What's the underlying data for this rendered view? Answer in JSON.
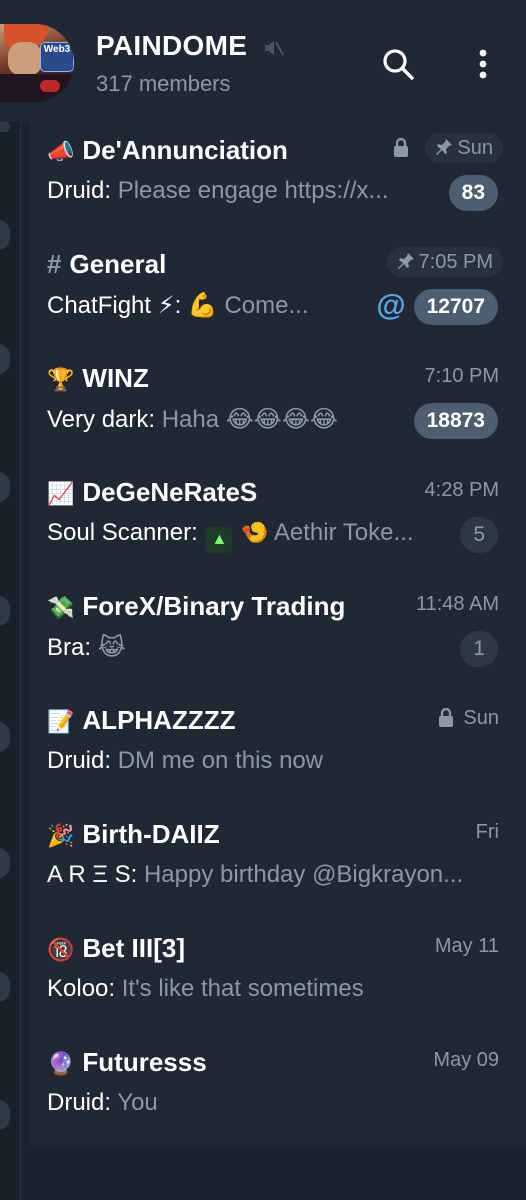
{
  "header": {
    "title": "PAINDOME",
    "subtitle": "317 members",
    "avatar_text": "Web3"
  },
  "chats": [
    {
      "icon": "📣",
      "name": "De'Annunciation",
      "time": "Sun",
      "pinned": true,
      "locked": true,
      "sender": "Druid:",
      "message": "Please engage   https://x...",
      "badge": "83",
      "badge_muted": false
    },
    {
      "icon": "#",
      "name": "General",
      "time": "7:05 PM",
      "pinned": true,
      "locked": false,
      "sender": "ChatFight ⚡:",
      "message": "💪 Come...",
      "badge": "12707",
      "badge_muted": false,
      "mention": "@"
    },
    {
      "icon": "🏆",
      "name": "WINZ",
      "time": "7:10 PM",
      "pinned": false,
      "locked": false,
      "sender": "Very dark:",
      "message": "Haha 😂😂😂😂",
      "badge": "18873",
      "badge_muted": false
    },
    {
      "icon": "📈",
      "name": "DeGeNeRateS",
      "time": "4:28 PM",
      "pinned": false,
      "locked": false,
      "sender": "Soul Scanner:",
      "message": "Aethir Toke...",
      "badge": "5",
      "badge_muted": true
    },
    {
      "icon": "💸",
      "name": "ForeX/Binary Trading",
      "time": "11:48 AM",
      "pinned": false,
      "locked": false,
      "sender": "Bra:",
      "message": "😹",
      "badge": "1",
      "badge_muted": true
    },
    {
      "icon": "📝",
      "name": "ALPHAZZZZ",
      "time": "Sun",
      "pinned": false,
      "locked": true,
      "sender": "Druid:",
      "message": "DM me on this now",
      "badge": "",
      "badge_muted": true
    },
    {
      "icon": "🎉",
      "name": "Birth-DAIIZ",
      "time": "Fri",
      "pinned": false,
      "locked": false,
      "sender": "A R Ξ S:",
      "message": "Happy birthday @Bigkrayon...",
      "badge": "",
      "badge_muted": true
    },
    {
      "icon": "🔞",
      "name": "Bet III[3]",
      "time": "May 11",
      "pinned": false,
      "locked": false,
      "sender": "Koloo:",
      "message": "It's like that sometimes",
      "badge": "",
      "badge_muted": true
    },
    {
      "icon": "🔮",
      "name": "Futuresss",
      "time": "May 09",
      "pinned": false,
      "locked": false,
      "sender": "Druid:",
      "message": "You",
      "badge": "",
      "badge_muted": true
    }
  ],
  "icons": {
    "mute": "mute-icon",
    "search": "search-icon",
    "menu": "more-vertical-icon",
    "pin": "pin-icon",
    "lock": "lock-icon"
  },
  "colors": {
    "background": "#1b232e",
    "row": "#1f2833",
    "secondary_text": "#8b98a6",
    "badge": "#4d5e71",
    "mention": "#5aa8e8"
  }
}
